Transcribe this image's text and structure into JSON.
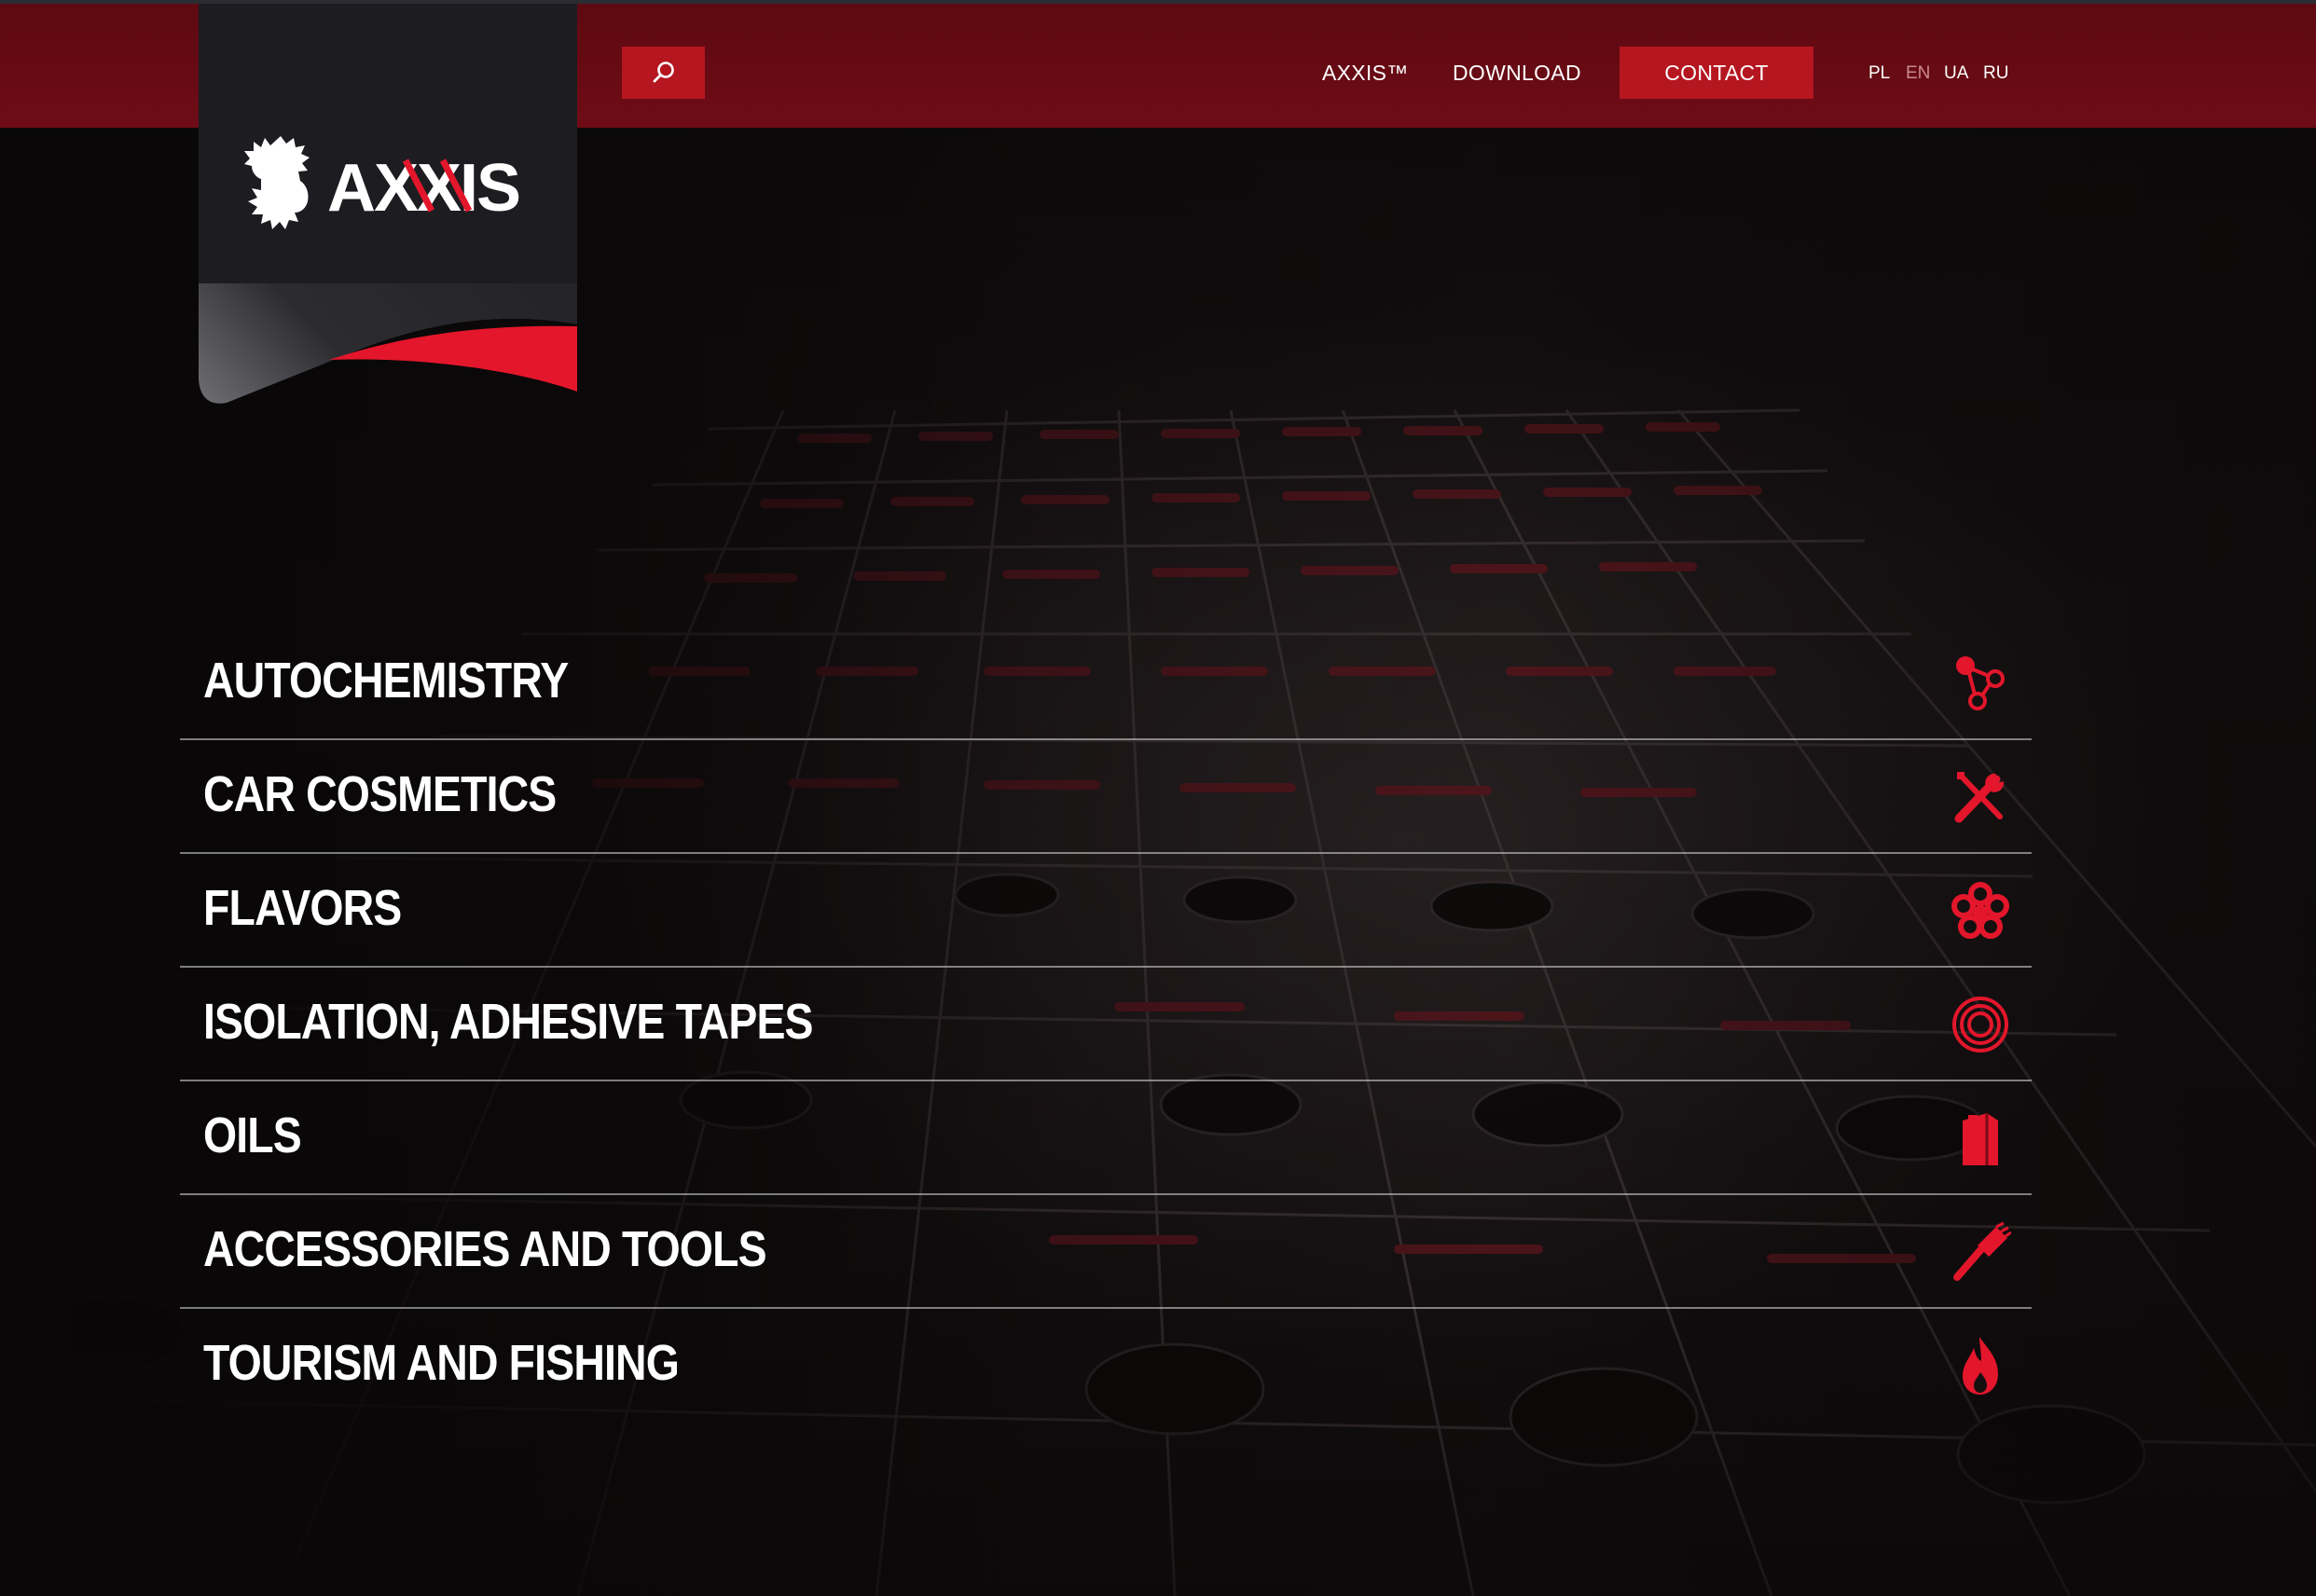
{
  "header": {
    "search_icon": "search-icon",
    "nav": [
      {
        "label": "AXXIS™"
      },
      {
        "label": "DOWNLOAD"
      },
      {
        "label": "CONTACT"
      }
    ],
    "languages": [
      {
        "code": "PL",
        "active": false
      },
      {
        "code": "EN",
        "active": true
      },
      {
        "code": "UA",
        "active": false
      },
      {
        "code": "RU",
        "active": false
      }
    ]
  },
  "logo": {
    "text": "AXXIS",
    "emblem": "lion-icon"
  },
  "categories": [
    {
      "label": "AUTOCHEMISTRY",
      "icon": "molecule-icon"
    },
    {
      "label": "CAR COSMETICS",
      "icon": "wrench-screwdriver-icon"
    },
    {
      "label": "FLAVORS",
      "icon": "flower-icon"
    },
    {
      "label": "ISOLATION, ADHESIVE TAPES",
      "icon": "tape-roll-icon"
    },
    {
      "label": "OILS",
      "icon": "oil-canister-icon"
    },
    {
      "label": "ACCESSORIES AND TOOLS",
      "icon": "brush-icon"
    },
    {
      "label": "TOURISM AND FISHING",
      "icon": "flame-icon"
    }
  ],
  "colors": {
    "header_bg": "#6e0c16",
    "accent": "#b5161f",
    "icon_red": "#e3162b",
    "text": "#ffffff"
  }
}
